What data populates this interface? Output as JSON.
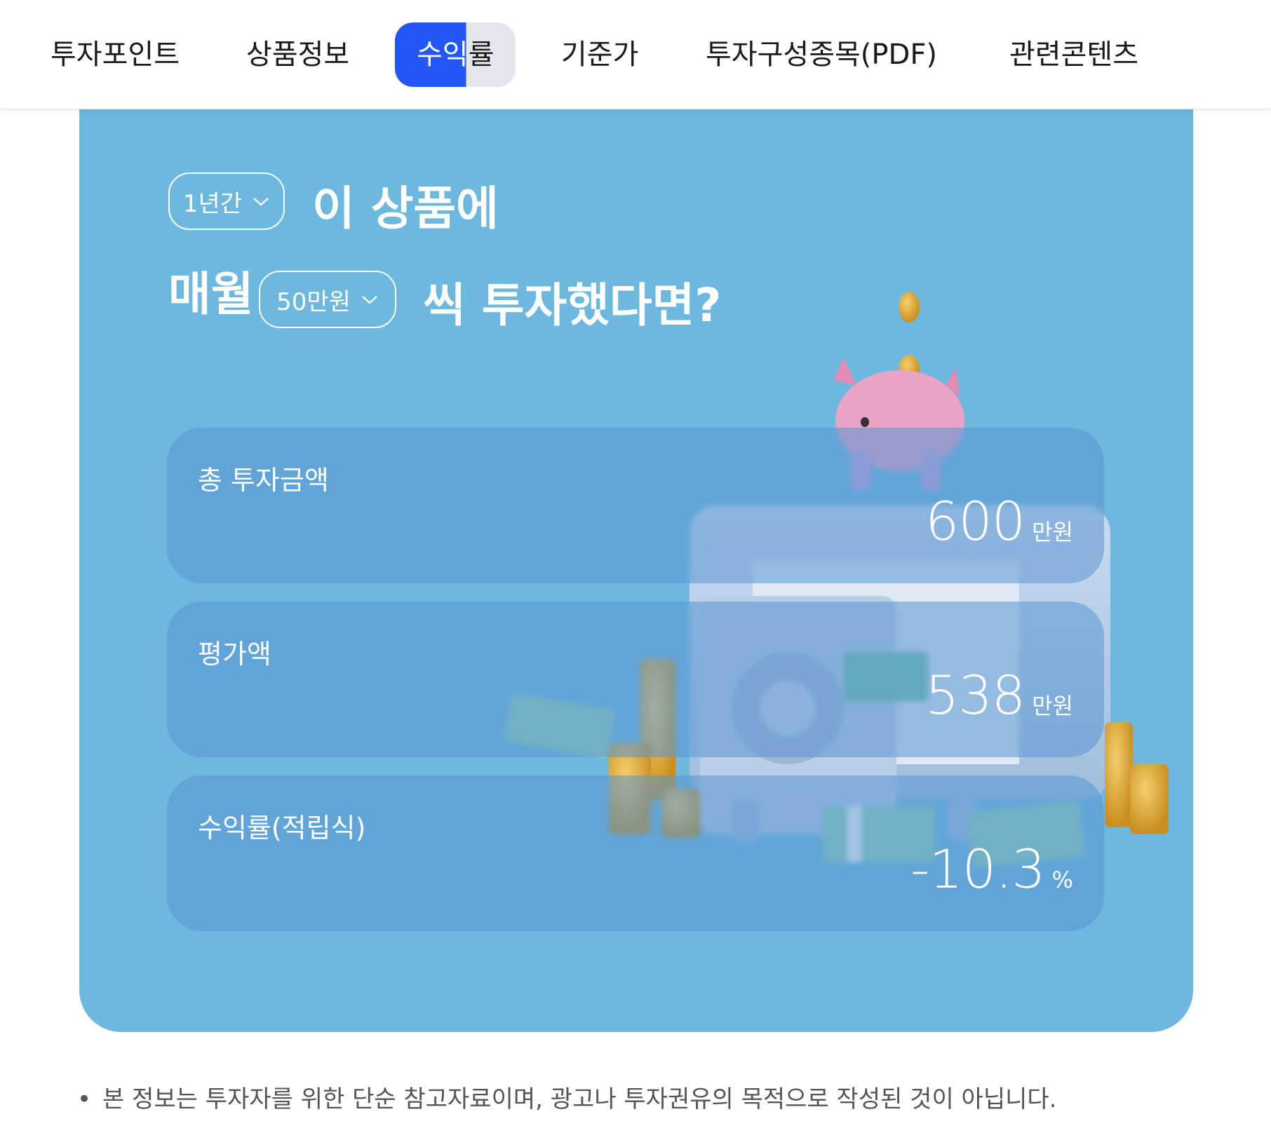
{
  "tabs": [
    {
      "label": "투자포인트"
    },
    {
      "label": "상품정보"
    },
    {
      "label_part1": "수익",
      "label_part2": "률"
    },
    {
      "label": "기준가"
    },
    {
      "label": "투자구성종목(PDF)"
    },
    {
      "label": "관련콘텐츠"
    }
  ],
  "colors": {
    "accent": "#2356f6",
    "card": "#6cb8df",
    "box": "#5a96d2"
  },
  "simulator": {
    "period_select": "1년간",
    "headline_1": "이 상품에",
    "headline_2_prefix": "매월",
    "amount_select": "50만원",
    "headline_2_suffix": "씩 투자했다면?"
  },
  "results": [
    {
      "label": "총 투자금액",
      "value": "600",
      "unit": "만원"
    },
    {
      "label": "평가액",
      "value": "538",
      "unit": "만원"
    },
    {
      "label": "수익률(적립식)",
      "value": "-10.3",
      "unit": "%"
    }
  ],
  "notice": {
    "bullet": "•",
    "text": "본 정보는 투자자를 위한 단순 참고자료이며, 광고나 투자권유의 목적으로 작성된 것이 아닙니다."
  }
}
